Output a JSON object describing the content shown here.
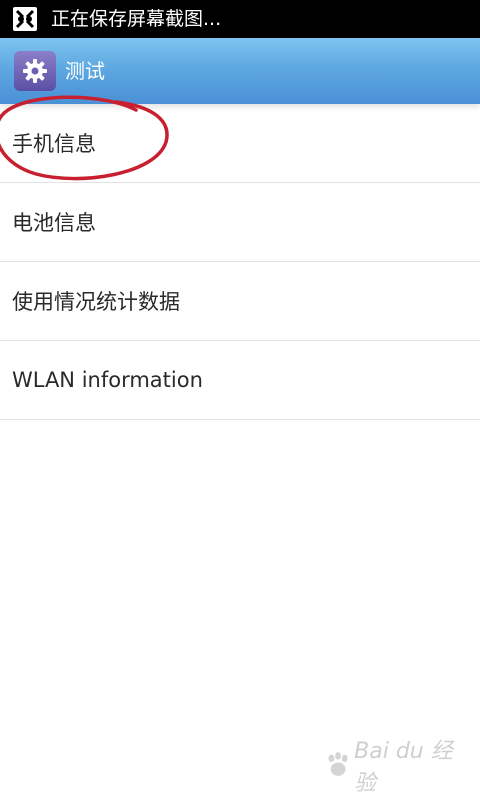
{
  "status_bar": {
    "text": "正在保存屏幕截图...",
    "icon": "screenshot-notification-icon"
  },
  "action_bar": {
    "title": "测试",
    "icon": "gear-icon"
  },
  "list": {
    "items": [
      {
        "label": "手机信息"
      },
      {
        "label": "电池信息"
      },
      {
        "label": "使用情况统计数据"
      },
      {
        "label": "WLAN information"
      }
    ]
  },
  "annotation": {
    "color": "#c8202f",
    "target": "手机信息"
  },
  "watermark": {
    "text": "Bai du 经验",
    "icon": "paw-icon"
  },
  "colors": {
    "status_bar": "#000000",
    "action_bar": "#5ea8e2",
    "divider": "#e2e2e2",
    "text": "#2a2a2a"
  }
}
